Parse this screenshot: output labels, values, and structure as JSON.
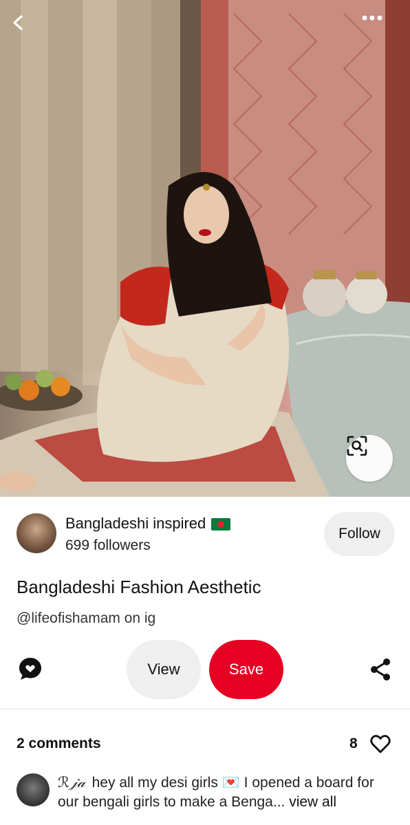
{
  "pin": {
    "image_alt": "Woman in cream and red saree seated before brocade curtains",
    "creator": {
      "name": "Bangladeshi inspired",
      "flag": "bangladesh-flag",
      "followers": "699 followers"
    },
    "follow_label": "Follow",
    "title": "Bangladeshi Fashion Aesthetic",
    "description": "@lifeofishamam on ig"
  },
  "actions": {
    "view_label": "View",
    "save_label": "Save"
  },
  "comments": {
    "count_label": "2 comments",
    "likes": "8",
    "first": {
      "author": "ℛ𝒿𝒶",
      "text": "hey all my desi girls 💌 I opened a board for our bengali girls to make a Benga...",
      "view_all": " view all"
    }
  },
  "colors": {
    "save": "#e60023",
    "button_gray": "#efefef",
    "text": "#111111"
  },
  "icons": [
    "back-arrow-icon",
    "more-dots-icon",
    "visual-search-icon",
    "comment-bubble-icon",
    "share-icon",
    "heart-icon"
  ]
}
